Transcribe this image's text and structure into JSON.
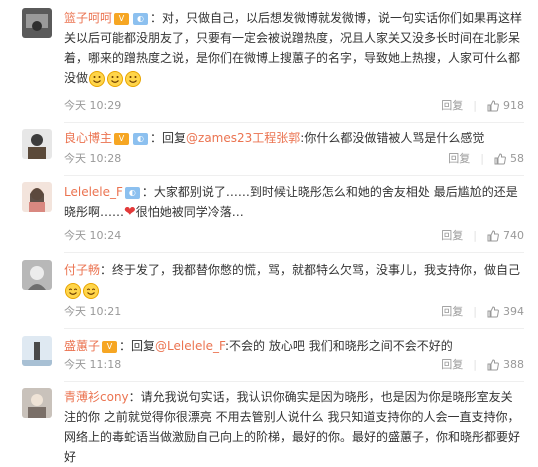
{
  "comments": [
    {
      "name": "篮子呵呵",
      "text": "：对，只做自己，以后想发微博就发微博，说一句实话你们如果再这样关以后可能都没朋友了，只要有一定会被说蹭热度，况且人家关又没多长时间在北影呆着，哪来的蹭热度之说，是你们在微博上搜蕙子的名字，导致她上热搜，人家可什么都没做",
      "time": "今天 10:29",
      "reply": "回复",
      "likes": "918"
    },
    {
      "name": "良心博主",
      "reply_prefix": "：回复",
      "mention": "@zames23工程张郭",
      "text": ":你什么都没做错被人骂是什么感觉",
      "time": "今天 10:28",
      "reply": "回复",
      "likes": "58"
    },
    {
      "name": "Lelelele_F",
      "text": "：大家都别说了……到时候让晓彤怎么和她的舍友相处 最后尴尬的还是晓彤啊……",
      "text2": "很怕她被同学冷落…",
      "time": "今天 10:24",
      "reply": "回复",
      "likes": "740"
    },
    {
      "name": "付子畅",
      "text": "：终于发了，我都替你憋的慌，骂，就都特么欠骂，没事儿，我支持你，做自己",
      "time": "今天 10:21",
      "reply": "回复",
      "likes": "394"
    },
    {
      "name": "盛蕙子",
      "reply_prefix": "：回复",
      "mention": "@Lelelele_F",
      "text": ":不会的 放心吧 我们和晓彤之间不会不好的",
      "time": "今天 11:18",
      "reply": "回复",
      "likes": "388"
    },
    {
      "name": "青薄衫cony",
      "text": "：请允我说句实话，我认识你确实是因为晓彤，也是因为你是晓彤室友关注的你 之前就觉得你很漂亮 不用去管别人说什么 我只知道支持你的人会一直支持你，网络上的毒蛇语当做激励自己向上的阶梯，最好的你。最好的盛蕙子，你和晓彤都要好好"
    }
  ]
}
